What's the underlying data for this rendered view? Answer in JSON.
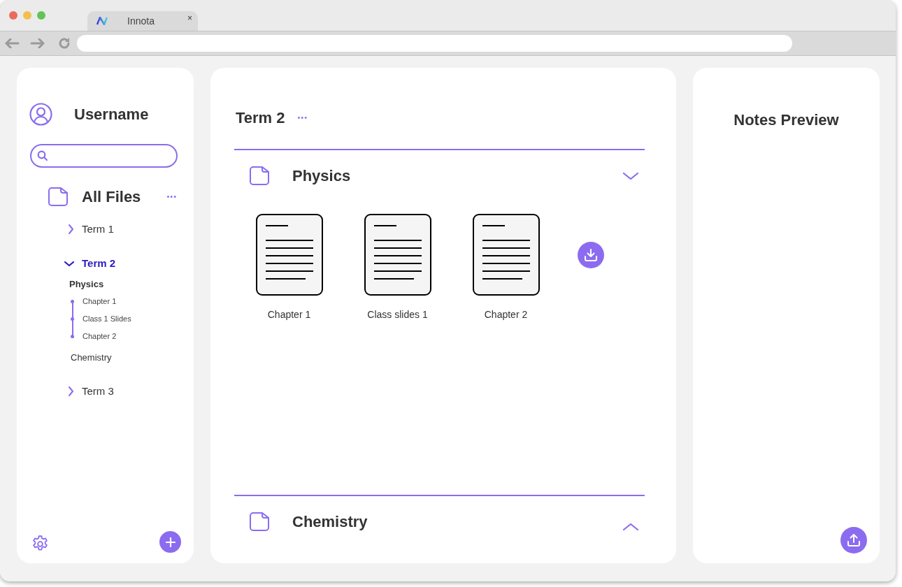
{
  "browser": {
    "tab_title": "Innota",
    "tab_close": "×"
  },
  "sidebar": {
    "username": "Username",
    "root": {
      "label": "All Files",
      "more": "•••"
    },
    "tree": [
      {
        "label": "Term 1",
        "expanded": false,
        "selected": false
      },
      {
        "label": "Term 2",
        "expanded": true,
        "selected": true,
        "children": [
          {
            "label": "Physics",
            "children": [
              {
                "label": "Chapter 1"
              },
              {
                "label": "Class 1 Slides"
              },
              {
                "label": "Chapter 2"
              }
            ]
          },
          {
            "label": "Chemistry"
          }
        ]
      },
      {
        "label": "Term 3",
        "expanded": false,
        "selected": false
      }
    ]
  },
  "main": {
    "title": "Term 2",
    "more": "•••",
    "sections": [
      {
        "title": "Physics",
        "expanded": true,
        "files": [
          {
            "name": "Chapter 1"
          },
          {
            "name": "Class slides 1"
          },
          {
            "name": "Chapter 2"
          }
        ]
      },
      {
        "title": "Chemistry",
        "expanded": false
      }
    ]
  },
  "preview": {
    "title": "Notes Preview"
  }
}
